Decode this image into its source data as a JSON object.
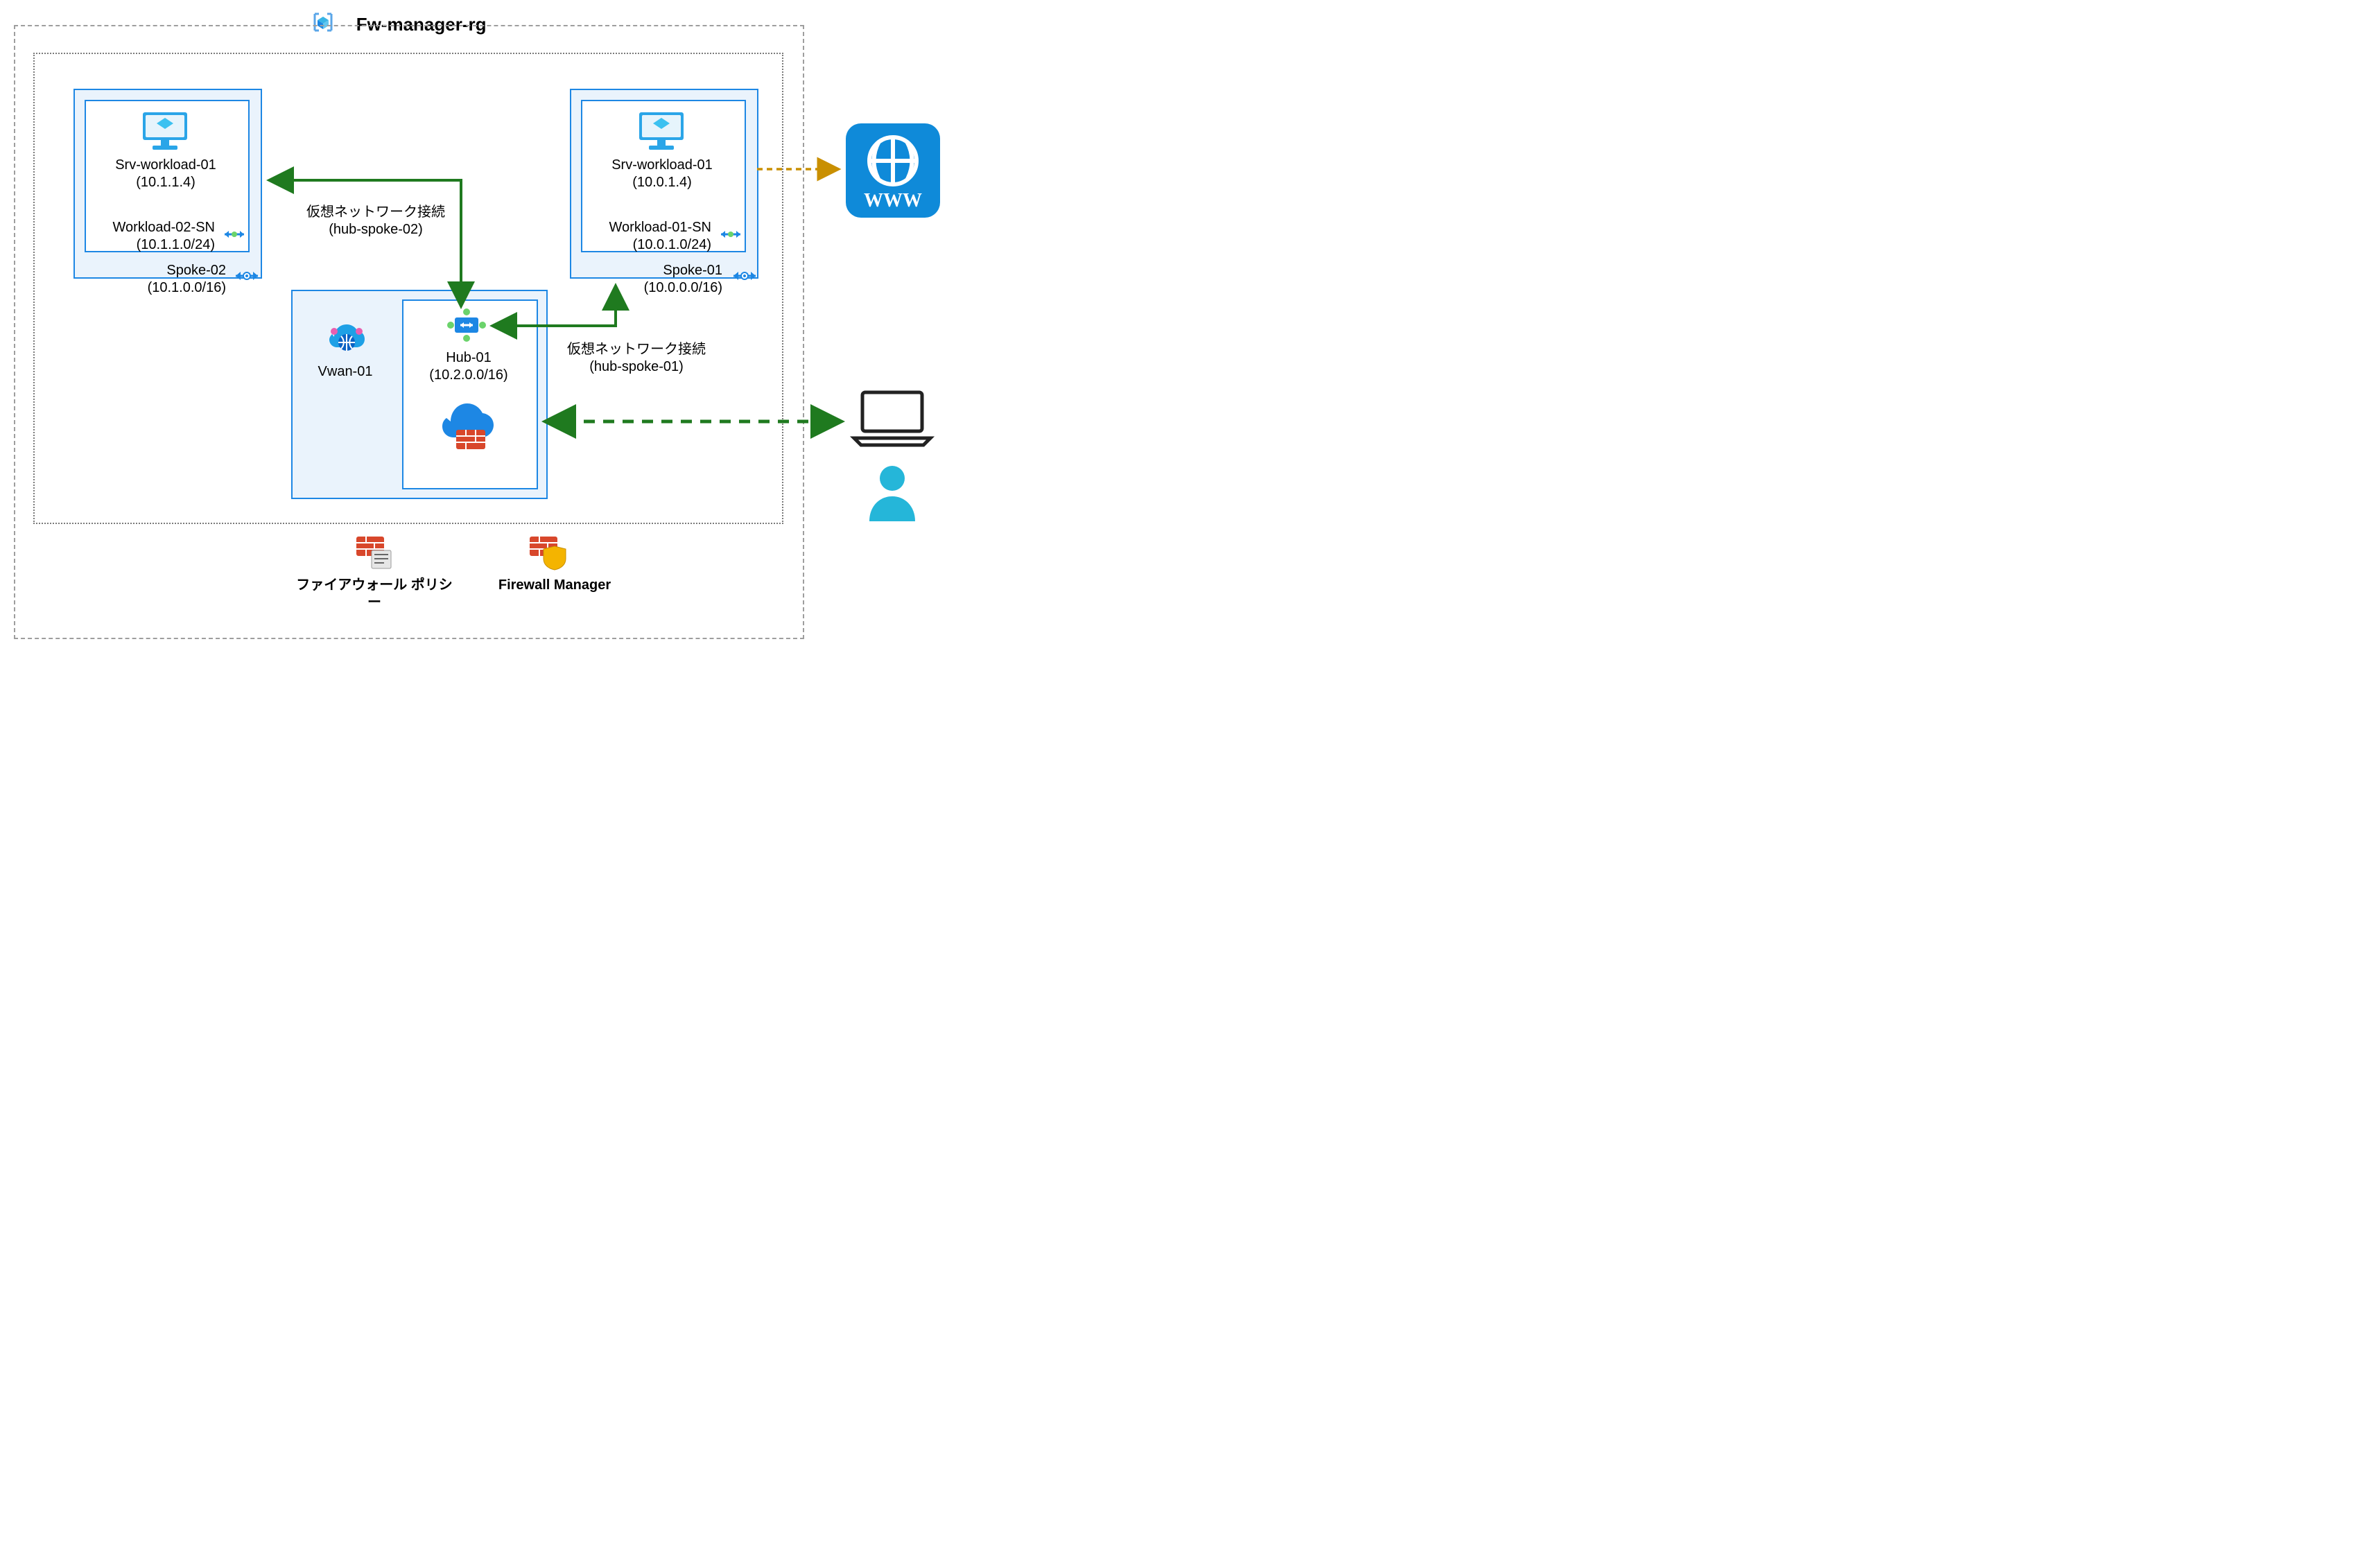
{
  "title": "Fw-manager-rg",
  "spoke02": {
    "vm_name": "Srv-workload-01",
    "vm_ip": "(10.1.1.4)",
    "sn_name": "Workload-02-SN",
    "sn_cidr": "(10.1.1.0/24)",
    "vnet_name": "Spoke-02",
    "vnet_cidr": "(10.1.0.0/16)"
  },
  "spoke01": {
    "vm_name": "Srv-workload-01",
    "vm_ip": "(10.0.1.4)",
    "sn_name": "Workload-01-SN",
    "sn_cidr": "(10.0.1.0/24)",
    "vnet_name": "Spoke-01",
    "vnet_cidr": "(10.0.0.0/16)"
  },
  "conn02": {
    "l1": "仮想ネットワーク接続",
    "l2": "(hub-spoke-02)"
  },
  "conn01": {
    "l1": "仮想ネットワーク接続",
    "l2": "(hub-spoke-01)"
  },
  "vwan": {
    "name": "Vwan-01"
  },
  "hub": {
    "name": "Hub-01",
    "cidr": "(10.2.0.0/16)"
  },
  "legend": {
    "policy": "ファイアウォール ポリシー",
    "manager": "Firewall Manager"
  },
  "www": "WWW"
}
